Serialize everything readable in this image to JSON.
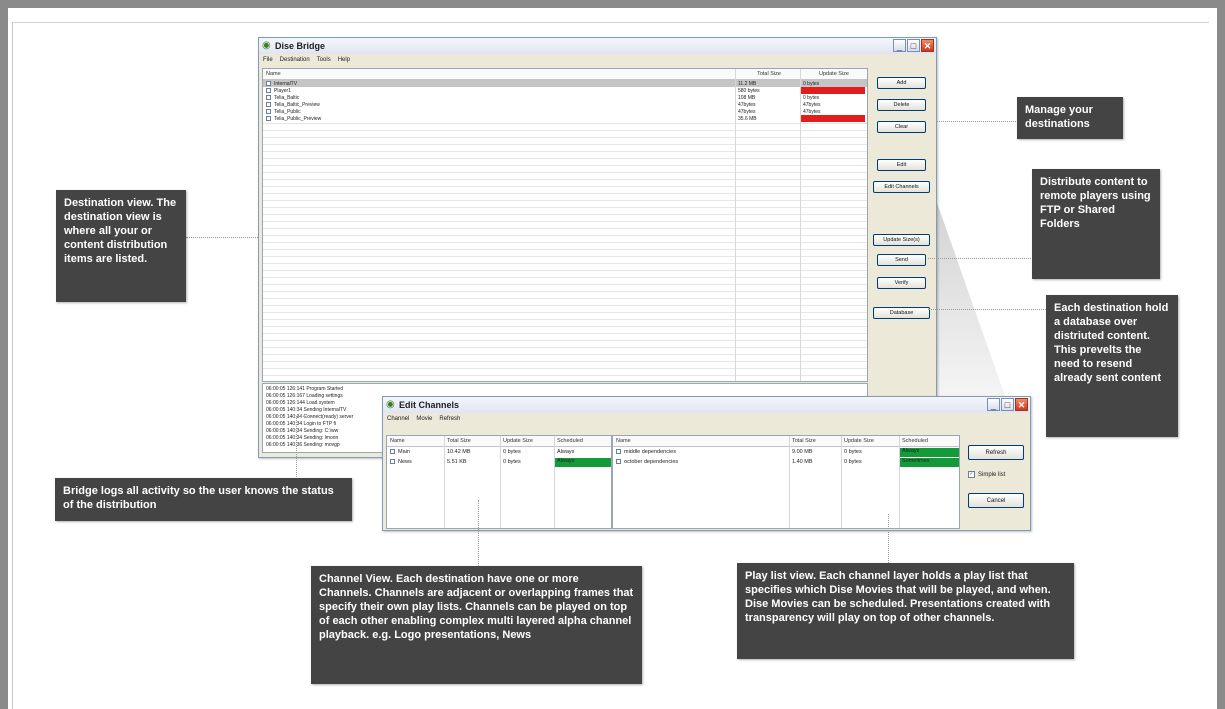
{
  "main_window": {
    "title": "Dise Bridge",
    "menu": [
      "File",
      "Destination",
      "Tools",
      "Help"
    ],
    "columns": [
      "Name",
      "Total Size",
      "Update Size"
    ],
    "rows": [
      {
        "name": "InternalTV",
        "total": "11.2 MB",
        "update": "0 bytes",
        "update_status": "none",
        "checked": false,
        "selected": true
      },
      {
        "name": "Player1",
        "total": "580 bytes",
        "update": "",
        "update_status": "red",
        "checked": true,
        "selected": false
      },
      {
        "name": "Telia_Baltic",
        "total": "108 MB",
        "update": "0 bytes",
        "update_status": "none",
        "checked": true,
        "selected": false
      },
      {
        "name": "Telia_Baltic_Preview",
        "total": "47bytes",
        "update": "47bytes",
        "update_status": "none",
        "checked": true,
        "selected": false
      },
      {
        "name": "Telia_Public",
        "total": "47bytes",
        "update": "47bytes",
        "update_status": "none",
        "checked": true,
        "selected": false
      },
      {
        "name": "Telia_Public_Preview",
        "total": "35.6 MB",
        "update": "",
        "update_status": "red",
        "checked": true,
        "selected": false
      }
    ],
    "buttons": {
      "add": "Add",
      "delete": "Delete",
      "clear": "Clear",
      "edit": "Edit",
      "edit_channels": "Edit Channels",
      "update_size": "Update Size(s)",
      "send": "Send",
      "verify": "Verify",
      "database": "Database"
    },
    "log": [
      "06:00:05 126:141 Program Started",
      "06:00:05 126:167 Loading settings",
      "06:00:05 126:144 Load system",
      "06:00:05 140:34 Sending InternalTV",
      "06:00:05 140:34 Connect(ready) server",
      "06:00:05 140:34 Login to FTP fi",
      "06:00:05 140:34 Sending: C:\\ww",
      "06:00:05 140:34 Sending: lmoon",
      "06:00:05 140:36 Sending: movgp"
    ]
  },
  "edit_channels": {
    "title": "Edit Channels",
    "menu": [
      "Channel",
      "Movie",
      "Refresh"
    ],
    "channel_columns": [
      "Name",
      "Total Size",
      "Update Size",
      "Scheduled"
    ],
    "channels": [
      {
        "name": "Main",
        "total": "10.42 MB",
        "update": "0 bytes",
        "scheduled": "Always",
        "scheduled_status": "none",
        "checked": true
      },
      {
        "name": "News",
        "total": "5.51 KB",
        "update": "0 bytes",
        "scheduled": "Always",
        "scheduled_status": "green",
        "checked": true
      }
    ],
    "playlist_columns": [
      "Name",
      "Total Size",
      "Update Size",
      "Scheduled"
    ],
    "playlist": [
      {
        "name": "middle dependencies",
        "total": "9.00 MB",
        "update": "0 bytes",
        "scheduled": "Always",
        "checked": true
      },
      {
        "name": "october dependencies",
        "total": "1.40 MB",
        "update": "0 bytes",
        "scheduled": "Sometimes",
        "checked": true
      }
    ],
    "buttons": {
      "refresh": "Refresh",
      "simple_list": "Simple list",
      "cancel": "Cancel"
    }
  },
  "callouts": {
    "manage": "Manage your destinations",
    "distribute": "Distribute content to remote players using FTP or Shared Folders",
    "destination_view": "Destination view. The destination view is where all your or content distribution items are listed.",
    "database": "Each destination hold a database over distriuted content. This prevelts the need to resend already sent content",
    "logs": "Bridge logs all activity so the user knows the status of the distribution",
    "channel_view": "Channel View. Each destination have one or more Channels. Channels are adjacent or overlapping frames that specify their own play lists. Channels can be played on top of each other enabling complex multi layered alpha channel playback. e.g. Logo presentations, News",
    "playlist_view": "Play list view. Each channel layer holds a play list that specifies which Dise Movies that will be played, and when. Dise Movies can be scheduled. Presentations created with transparency will play on top of other channels."
  },
  "colors": {
    "red": "#e31c1c",
    "green": "#159a3a",
    "callout_bg": "#444444"
  }
}
